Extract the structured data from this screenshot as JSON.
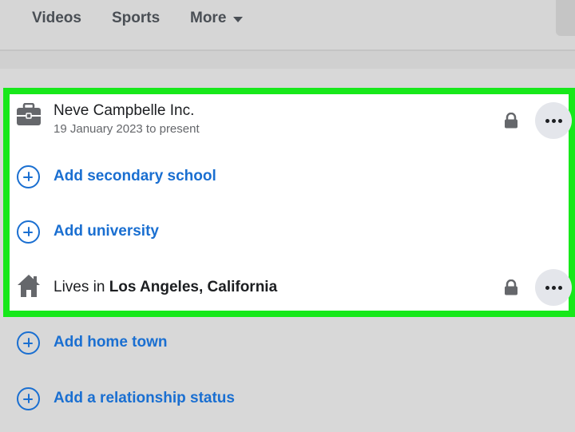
{
  "nav": {
    "items": [
      {
        "label": "Videos"
      },
      {
        "label": "Sports"
      },
      {
        "label": "More"
      }
    ]
  },
  "work": {
    "title": "Neve Campbelle Inc.",
    "subtitle": "19 January 2023 to present",
    "icon": "briefcase-icon"
  },
  "add_secondary_school": "Add secondary school",
  "add_university": "Add university",
  "lives_in": {
    "prefix": "Lives in",
    "place": "Los Angeles, California",
    "icon": "house-icon"
  },
  "add_home_town": "Add home town",
  "add_relationship_status": "Add a relationship status",
  "colors": {
    "highlight_border": "#17e81a",
    "link_blue": "#1a6fd1",
    "background": "#d8d8d8"
  }
}
